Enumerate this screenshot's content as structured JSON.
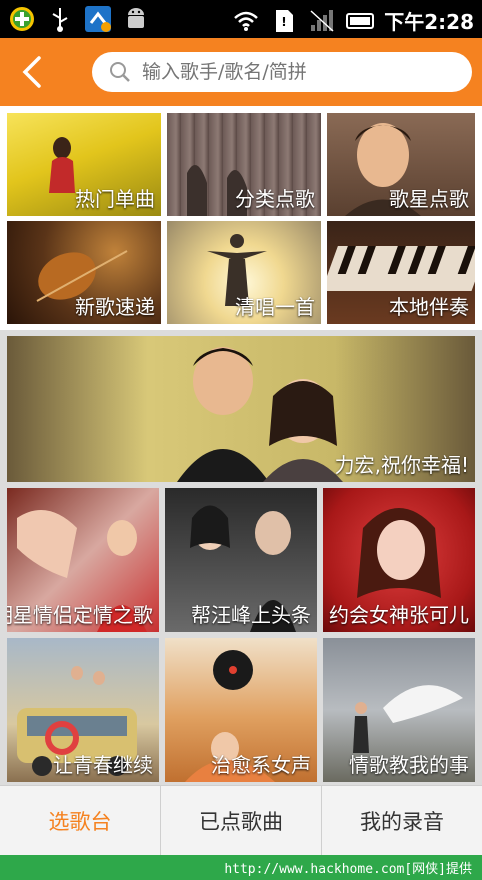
{
  "status_bar": {
    "time": "下午2:28",
    "icons": [
      "app-badge-icon",
      "usb-icon",
      "sync-icon",
      "android-icon",
      "wifi-icon",
      "sd-card-icon",
      "signal-icon",
      "battery-icon"
    ]
  },
  "header": {
    "search_placeholder": "输入歌手/歌名/简拼",
    "accent_color": "#f58220"
  },
  "categories": [
    {
      "label": "热门单曲"
    },
    {
      "label": "分类点歌"
    },
    {
      "label": "歌星点歌"
    },
    {
      "label": "新歌速递"
    },
    {
      "label": "清唱一首"
    },
    {
      "label": "本地伴奏"
    }
  ],
  "features": [
    {
      "label": "力宏,祝你幸福!"
    },
    {
      "label": "明星情侣定情之歌"
    },
    {
      "label": "帮汪峰上头条"
    },
    {
      "label": "约会女神张可儿"
    },
    {
      "label": "让青春继续"
    },
    {
      "label": "治愈系女声"
    },
    {
      "label": "情歌教我的事"
    }
  ],
  "tabs": [
    {
      "label": "选歌台",
      "active": true
    },
    {
      "label": "已点歌曲",
      "active": false
    },
    {
      "label": "我的录音",
      "active": false
    }
  ],
  "footer": {
    "watermark": "http://www.hackhome.com[网侠]提供"
  }
}
